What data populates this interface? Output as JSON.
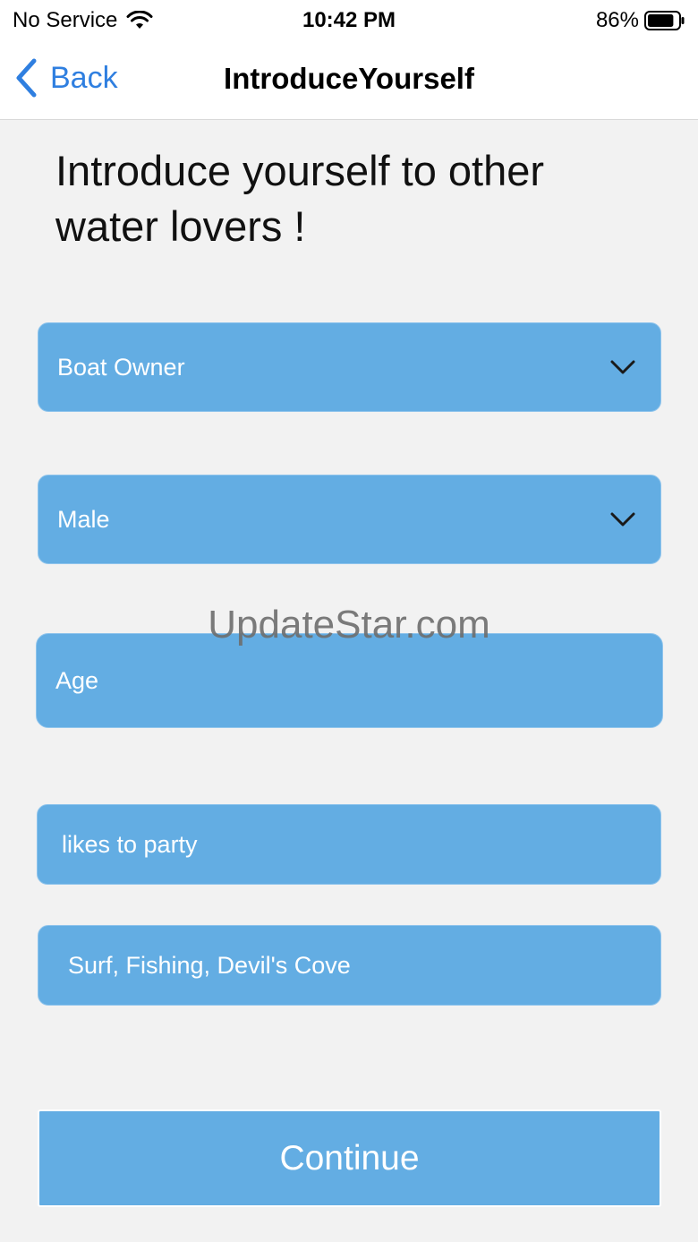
{
  "status_bar": {
    "carrier": "No Service",
    "time": "10:42 PM",
    "battery_percent": "86%",
    "battery_level": 0.86
  },
  "nav": {
    "back_label": "Back",
    "title": "IntroduceYourself"
  },
  "headline": "Introduce yourself to other water lovers !",
  "form": {
    "role_select": {
      "value": "Boat Owner"
    },
    "gender_select": {
      "value": "Male"
    },
    "age_input": {
      "placeholder": "Age"
    },
    "bio_input": {
      "value": "likes to party"
    },
    "interests_input": {
      "value": "Surf, Fishing, Devil's Cove"
    }
  },
  "watermark": "UpdateStar.com",
  "continue_label": "Continue",
  "colors": {
    "field_bg": "#63ade3",
    "link_blue": "#2f7fe0",
    "page_bg": "#f2f2f2"
  }
}
